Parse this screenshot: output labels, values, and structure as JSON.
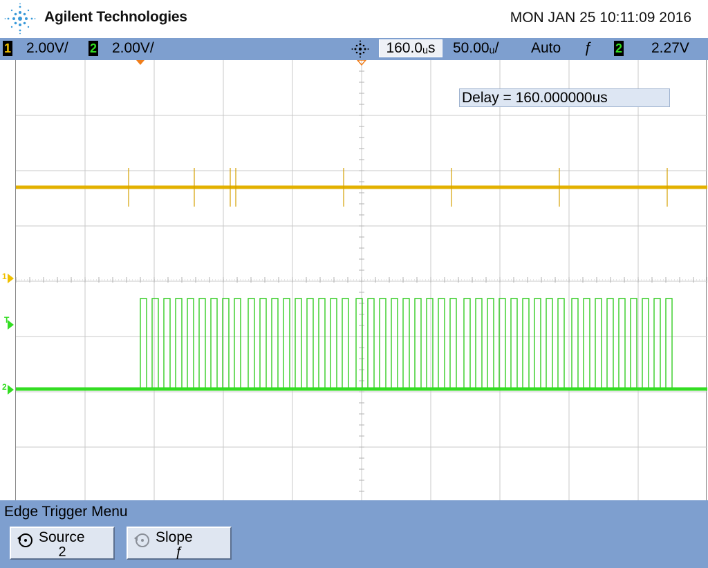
{
  "header": {
    "brand": "Agilent Technologies",
    "datetime": "MON JAN 25 10:11:09 2016",
    "logo_icon": "agilent-spark-logo-icon"
  },
  "status": {
    "ch1_number": "1",
    "ch1_scale": "2.00V/",
    "ch2_number": "2",
    "ch2_scale": "2.00V/",
    "delay_value": "160.0ᵤs",
    "timebase": "50.00ᵤ/",
    "trigger_mode": "Auto",
    "trigger_slope_glyph": "ƒ",
    "trigger_source": "2",
    "trigger_level": "2.27V",
    "ch1_color": "#f0c000",
    "ch2_color": "#33dd22"
  },
  "screen": {
    "delay_readout": "Delay = 160.000000us",
    "ch1_marker": "1",
    "trigger_marker": "T",
    "ch2_marker": "2"
  },
  "menu": {
    "title": "Edge Trigger Menu",
    "softkeys": [
      {
        "label": "Source",
        "value": "2",
        "icon": "rotary-knob-icon"
      },
      {
        "label": "Slope",
        "value": "ƒ",
        "icon": "rotary-knob-icon"
      }
    ]
  }
}
